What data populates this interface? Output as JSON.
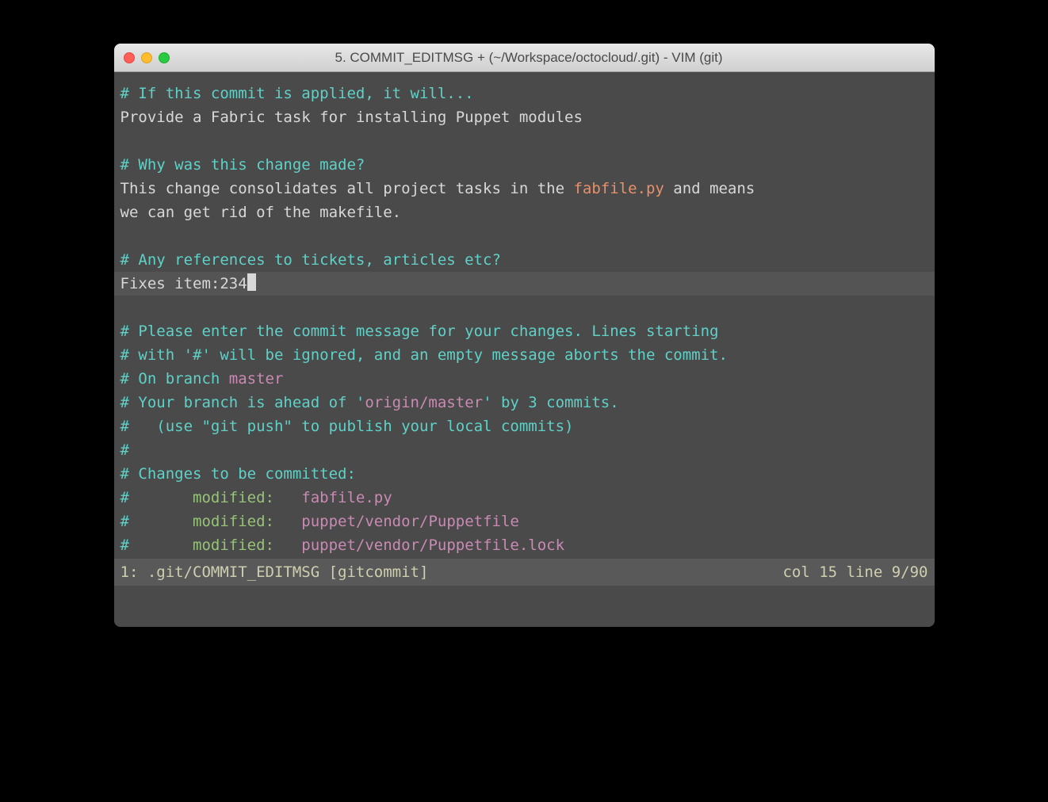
{
  "window": {
    "title": "5. COMMIT_EDITMSG + (~/Workspace/octocloud/.git) - VIM (git)"
  },
  "editor": {
    "line1_comment": "# If this commit is applied, it will...",
    "line2": "Provide a Fabric task for installing Puppet modules",
    "line4_comment": "# Why was this change made?",
    "line5_pre": "This change consolidates all project tasks in the ",
    "line5_hl": "fabfile.py",
    "line5_post": " and means",
    "line6": "we can get rid of the makefile.",
    "line8_comment": "# Any references to tickets, articles etc?",
    "line9": "Fixes item:234",
    "line11_comment": "# Please enter the commit message for your changes. Lines starting",
    "line12_comment": "# with '#' will be ignored, and an empty message aborts the commit.",
    "line13_pre": "# On branch ",
    "line13_branch": "master",
    "line14_pre": "# Your branch is ahead of '",
    "line14_remote": "origin/master",
    "line14_post": "' by 3 commits.",
    "line15_comment": "#   (use \"git push\" to publish your local commits)",
    "line16_comment": "#",
    "line17_comment": "# Changes to be committed:",
    "line18_hash": "#",
    "line18_mod": "       modified:   ",
    "line18_file": "fabfile.py",
    "line19_hash": "#",
    "line19_mod": "       modified:   ",
    "line19_file": "puppet/vendor/Puppetfile",
    "line20_hash": "#",
    "line20_mod": "       modified:   ",
    "line20_file": "puppet/vendor/Puppetfile.lock"
  },
  "statusbar": {
    "left": "1: .git/COMMIT_EDITMSG [gitcommit]",
    "right": "col 15 line 9/90 "
  }
}
